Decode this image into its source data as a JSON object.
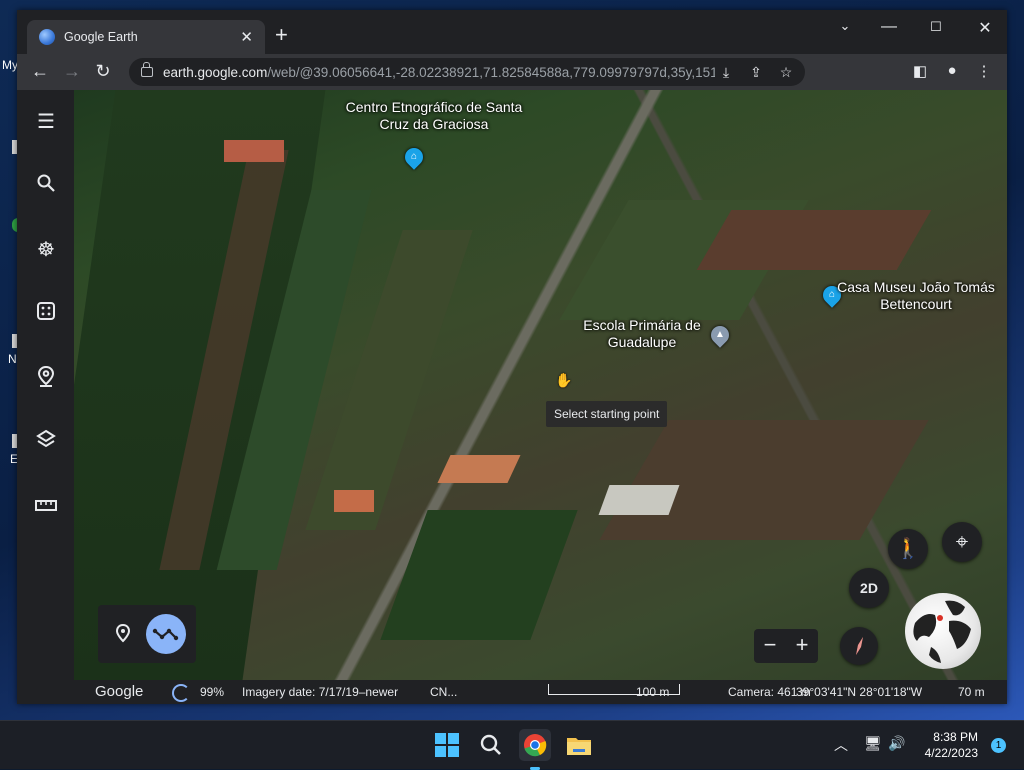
{
  "desktop": {
    "labels": [
      "My",
      "N",
      "E"
    ]
  },
  "browser": {
    "tab_title": "Google Earth",
    "url_host": "earth.google.com",
    "url_rest": "/web/@39.06056641,-28.02238921,71.82584588a,779.09979797d,35y,151.48838495..."
  },
  "map": {
    "places": [
      {
        "name": "Centro Etnográfico de Santa Cruz da Graciosa",
        "icon": "museum-icon"
      },
      {
        "name": "Escola Primária de Guadalupe",
        "icon": "school-icon"
      },
      {
        "name": "Casa Museu João Tomás Bettencourt",
        "icon": "museum-icon"
      }
    ],
    "tooltip": "Select starting point",
    "view_mode": "2D"
  },
  "status": {
    "brand": "Google",
    "load_pct": "99%",
    "imagery": "Imagery date: 7/17/19–newer",
    "provider": "CN...",
    "scale": "100 m",
    "camera": "Camera: 461 m",
    "coords": "39°03'41\"N 28°01'18\"W",
    "elevation": "70 m"
  },
  "taskbar": {
    "time": "8:38 PM",
    "date": "4/22/2023",
    "notifications": "1"
  },
  "colors": {
    "museum_pin": "#1aa3e8",
    "school_pin": "#8a9bb0",
    "accent_blue": "#8ab4f8"
  }
}
